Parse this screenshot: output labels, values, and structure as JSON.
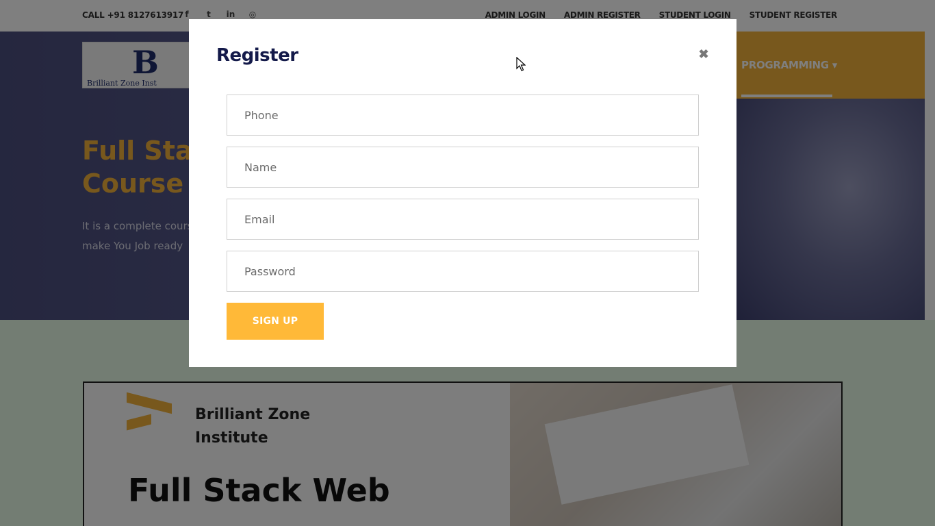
{
  "topbar": {
    "call": "CALL +91 8127613917",
    "socials": [
      {
        "icon": "facebook-icon",
        "glyph": "f"
      },
      {
        "icon": "twitter-icon",
        "glyph": "t"
      },
      {
        "icon": "linkedin-icon",
        "glyph": "in"
      },
      {
        "icon": "instagram-icon",
        "glyph": "◎"
      }
    ],
    "links": [
      "ADMIN LOGIN",
      "ADMIN REGISTER",
      "STUDENT LOGIN",
      "STUDENT REGISTER"
    ]
  },
  "header": {
    "logo_letter": "B",
    "logo_text": "Brilliant Zone Inst",
    "nav_item": "PROGRAMMING",
    "nav_caret": "▾"
  },
  "hero": {
    "title_line1": "Full Stac",
    "title_line2": "Course",
    "desc_line1": "It is a complete cours",
    "desc_line2": "make You Job ready"
  },
  "banner": {
    "brand_line1": "Brilliant Zone",
    "brand_line2": "Institute",
    "title": "Full Stack Web"
  },
  "modal": {
    "title": "Register",
    "close": "✖",
    "fields": {
      "phone": {
        "placeholder": "Phone",
        "value": ""
      },
      "name": {
        "placeholder": "Name",
        "value": ""
      },
      "email": {
        "placeholder": "Email",
        "value": ""
      },
      "password": {
        "placeholder": "Password",
        "value": ""
      }
    },
    "submit_label": "SIGN UP"
  },
  "colors": {
    "accent": "#ffb938",
    "nav_bg": "#f0b13a",
    "title": "#141a4a"
  }
}
